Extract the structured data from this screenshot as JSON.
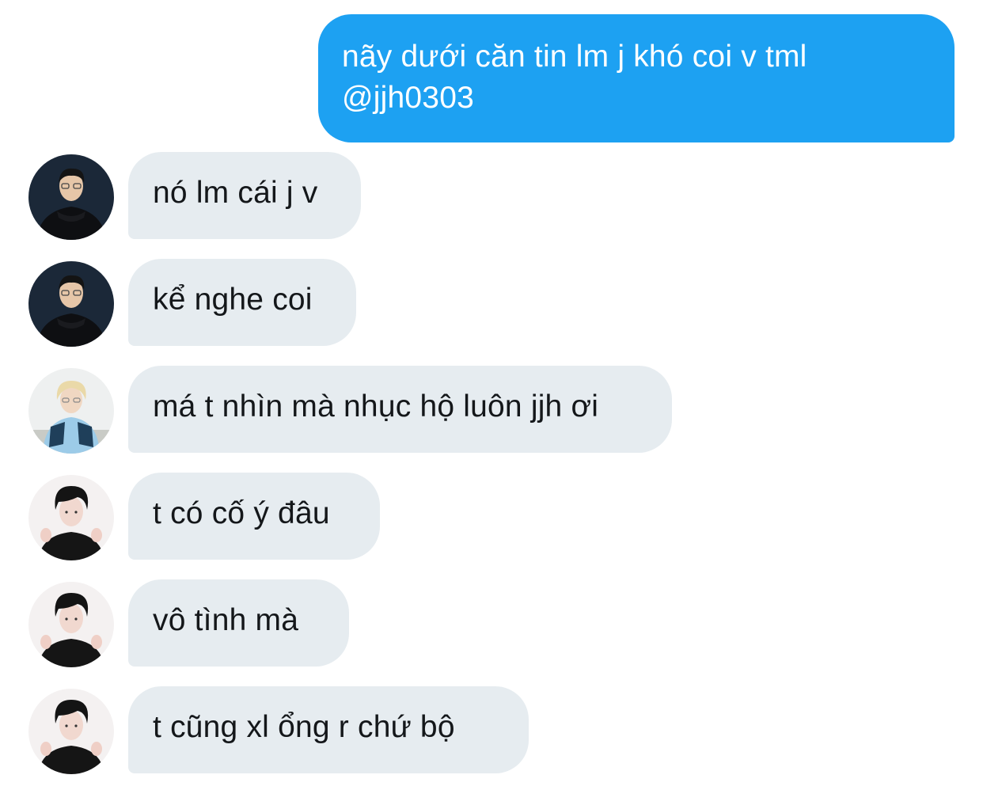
{
  "conversation": {
    "sent_message": {
      "lines": [
        "nãy dưới căn tin lm j khó coi v tml",
        "@jjh0303"
      ]
    },
    "received_messages": [
      {
        "text": "nó lm cái j v",
        "avatar": "avatar-glasses-dark-hoodie"
      },
      {
        "text": "kể nghe coi",
        "avatar": "avatar-glasses-dark-hoodie"
      },
      {
        "text": "má t nhìn mà nhục hộ luôn jjh ơi",
        "avatar": "avatar-blonde-blue-jacket"
      },
      {
        "text": "t có cố ý đâu",
        "avatar": "avatar-dark-hair-black-shirt"
      },
      {
        "text": "vô tình mà",
        "avatar": "avatar-dark-hair-black-shirt"
      },
      {
        "text": "t cũng xl ổng r chứ bộ",
        "avatar": "avatar-dark-hair-black-shirt"
      }
    ]
  },
  "colors": {
    "sent_bubble": "#1da1f2",
    "received_bubble": "#e6ecf0",
    "received_text": "#14171a"
  }
}
